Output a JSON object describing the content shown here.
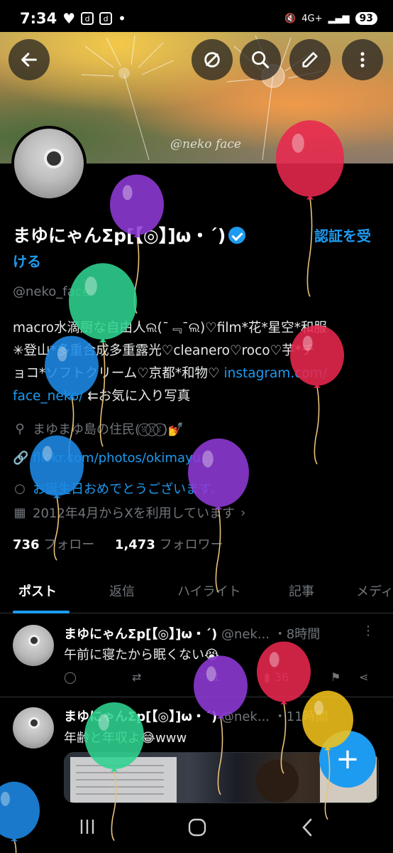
{
  "status_bar": {
    "time": "7:34",
    "network": "4G+",
    "battery": "93"
  },
  "header": {
    "banner_watermark": "@neko face",
    "back_icon": "arrow-left-icon",
    "hide_icon": "eye-off-icon",
    "search_icon": "search-icon",
    "edit_icon": "pencil-icon",
    "more_icon": "more-vertical-icon"
  },
  "profile": {
    "display_name": "まゆにゃんΣp[【◎】]ω・´)",
    "get_verified_1": "認証を受",
    "get_verified_2": "ける",
    "handle": "@neko_face",
    "bio_line1": "macro水滴厨な自由人ଲ(ˉ﹃ˉଲ)♡film*花*星空*和服",
    "bio_line2": "✳︎登山*多重合成多重露光♡cleanero♡roco♡芋*チ",
    "bio_line3_text": "ョコ*ソフトクリーム♡京都*和物♡ ",
    "bio_line3_link": "instagram.com/",
    "bio_line4_link": "face_neko/",
    "bio_line4_text": " ⇇お気に入り写真",
    "location": "まゆまゆ島の住民(⍤⃝⍤⃝⍤⃝)💅",
    "website": "flickr.com/photos/okimayu...",
    "birthday": "お誕生日おめでとうございます。",
    "joined": "2012年4月からXを利用しています",
    "following_count": "736",
    "following_label": "フォロー",
    "followers_count": "1,473",
    "followers_label": "フォロワー"
  },
  "tabs": [
    "ポスト",
    "返信",
    "ハイライト",
    "記事",
    "メディ"
  ],
  "posts": [
    {
      "name": "まゆにゃんΣp[【◎】]ω・´)",
      "handle": "@nek...",
      "time": "・8時間",
      "text": "午前に寝たから眠くない😭",
      "likes": "1",
      "views": "36"
    },
    {
      "name": "まゆにゃんΣp[【◎】]ω・´)",
      "handle": "@nek...",
      "time": "・11時間",
      "text": "年齢と年収よ😂www"
    }
  ],
  "fab_label": "+",
  "balloon_colors": {
    "purple": "#8e3ad6",
    "red": "#e8284f",
    "green": "#2fd38f",
    "blue": "#1e8ae6",
    "yellow": "#f2c21b"
  }
}
